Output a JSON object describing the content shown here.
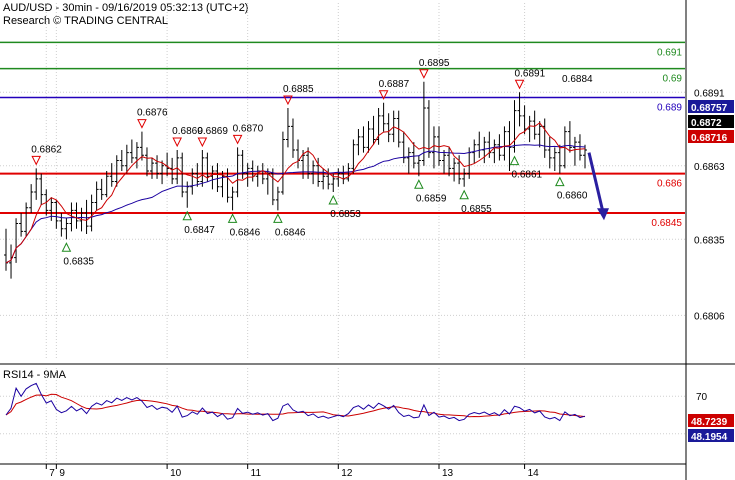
{
  "header": {
    "line1": "AUD/USD - 30min - 09/16/2019 05:32:13 (UTC+2)",
    "line2": "Research © TRADING CENTRAL"
  },
  "colors": {
    "candle": "#000000",
    "ma_fast": "#cc0000",
    "ma_slow": "#1a00a0",
    "level_red": "#e00000",
    "level_green": "#1f8a1f",
    "level_blue": "#2200bb",
    "grid": "#cfcfcf",
    "arrow": "#2a1fa0",
    "rsi": "#1a00a0",
    "rsi_ma": "#cc0000"
  },
  "chart_data": [
    {
      "type": "candlestick",
      "title": "AUD/USD - 30min",
      "ylim": [
        0.6789,
        0.6925
      ],
      "y_ticks": [
        0.6891,
        0.6863,
        0.6835,
        0.6806
      ],
      "x_ticks": [
        "7",
        "9",
        "10",
        "11",
        "12",
        "13",
        "14"
      ],
      "price_tags": [
        {
          "value": 0.68757,
          "label": "0.68757",
          "bg": "#1a1a99",
          "fg": "#ffffff"
        },
        {
          "value": 0.6872,
          "label": "0.6872",
          "bg": "#000000",
          "fg": "#ffffff"
        },
        {
          "value": 0.68716,
          "label": "0.68716",
          "bg": "#cc0000",
          "fg": "#ffffff"
        }
      ],
      "levels": [
        {
          "value": 0.691,
          "label": "0.691",
          "color": "level_green"
        },
        {
          "value": 0.69,
          "label": "0.69",
          "color": "level_green"
        },
        {
          "value": 0.6889,
          "label": "0.689",
          "color": "level_blue"
        },
        {
          "value": 0.686,
          "label": "0.686",
          "color": "level_red"
        },
        {
          "value": 0.6845,
          "label": "0.6845",
          "color": "level_red"
        }
      ],
      "swing_highs": [
        {
          "i": 6,
          "label": "0.6862"
        },
        {
          "i": 27,
          "label": "0.6876"
        },
        {
          "i": 34,
          "label": "0.6869"
        },
        {
          "i": 39,
          "label": "0.6869"
        },
        {
          "i": 46,
          "label": "0.6870"
        },
        {
          "i": 56,
          "label": "0.6885"
        },
        {
          "i": 75,
          "label": "0.6887"
        },
        {
          "i": 83,
          "label": "0.6895"
        },
        {
          "i": 102,
          "label": "0.6891"
        }
      ],
      "swing_lows": [
        {
          "i": 12,
          "label": "0.6835"
        },
        {
          "i": 36,
          "label": "0.6847"
        },
        {
          "i": 45,
          "label": "0.6846"
        },
        {
          "i": 54,
          "label": "0.6846"
        },
        {
          "i": 65,
          "label": "0.6853"
        },
        {
          "i": 82,
          "label": "0.6859"
        },
        {
          "i": 91,
          "label": "0.6855"
        },
        {
          "i": 101,
          "label": "0.6861"
        },
        {
          "i": 110,
          "label": "0.6860"
        }
      ],
      "top_right_label": "0.6884",
      "forecast_arrow": {
        "from": 0.6868,
        "to": 0.6843
      },
      "candles": [
        [
          0.6829,
          0.6839,
          0.6823,
          0.6826
        ],
        [
          0.6826,
          0.6833,
          0.682,
          0.6828
        ],
        [
          0.6828,
          0.6843,
          0.6826,
          0.6841
        ],
        [
          0.6841,
          0.6845,
          0.6836,
          0.6838
        ],
        [
          0.6838,
          0.6849,
          0.6836,
          0.6847
        ],
        [
          0.6847,
          0.6856,
          0.6845,
          0.6853
        ],
        [
          0.6853,
          0.6862,
          0.685,
          0.6858
        ],
        [
          0.6858,
          0.686,
          0.6848,
          0.6852
        ],
        [
          0.6852,
          0.6854,
          0.6844,
          0.6846
        ],
        [
          0.6846,
          0.6851,
          0.6842,
          0.6849
        ],
        [
          0.6849,
          0.685,
          0.6839,
          0.6842
        ],
        [
          0.6842,
          0.6845,
          0.6836,
          0.6839
        ],
        [
          0.6839,
          0.6843,
          0.6835,
          0.6841
        ],
        [
          0.6841,
          0.6849,
          0.6838,
          0.6846
        ],
        [
          0.6846,
          0.6849,
          0.6839,
          0.6842
        ],
        [
          0.6842,
          0.6847,
          0.6838,
          0.6845
        ],
        [
          0.6845,
          0.685,
          0.6837,
          0.684
        ],
        [
          0.684,
          0.6852,
          0.6838,
          0.6849
        ],
        [
          0.6849,
          0.6857,
          0.6846,
          0.6854
        ],
        [
          0.6854,
          0.6858,
          0.685,
          0.6852
        ],
        [
          0.6852,
          0.6861,
          0.6851,
          0.6859
        ],
        [
          0.6859,
          0.6864,
          0.6855,
          0.6857
        ],
        [
          0.6857,
          0.6867,
          0.6855,
          0.6865
        ],
        [
          0.6865,
          0.6869,
          0.6861,
          0.6863
        ],
        [
          0.6863,
          0.6871,
          0.686,
          0.6868
        ],
        [
          0.6868,
          0.6873,
          0.6864,
          0.6866
        ],
        [
          0.6866,
          0.6872,
          0.6862,
          0.687
        ],
        [
          0.687,
          0.6876,
          0.6865,
          0.6867
        ],
        [
          0.6867,
          0.687,
          0.6859,
          0.6861
        ],
        [
          0.6861,
          0.6866,
          0.6858,
          0.6864
        ],
        [
          0.6864,
          0.6867,
          0.6858,
          0.686
        ],
        [
          0.686,
          0.6865,
          0.6856,
          0.6863
        ],
        [
          0.6863,
          0.6868,
          0.6859,
          0.6862
        ],
        [
          0.6862,
          0.6866,
          0.6856,
          0.6858
        ],
        [
          0.6858,
          0.6869,
          0.6856,
          0.6866
        ],
        [
          0.6866,
          0.6868,
          0.6851,
          0.6853
        ],
        [
          0.6853,
          0.6857,
          0.6847,
          0.6855
        ],
        [
          0.6855,
          0.6862,
          0.6852,
          0.686
        ],
        [
          0.686,
          0.6864,
          0.6855,
          0.6857
        ],
        [
          0.6857,
          0.6869,
          0.6855,
          0.6866
        ],
        [
          0.6866,
          0.6868,
          0.6857,
          0.6859
        ],
        [
          0.6859,
          0.6863,
          0.6854,
          0.6861
        ],
        [
          0.6861,
          0.6864,
          0.6853,
          0.6855
        ],
        [
          0.6855,
          0.6861,
          0.6851,
          0.6859
        ],
        [
          0.6859,
          0.6862,
          0.6849,
          0.6851
        ],
        [
          0.6851,
          0.6855,
          0.6846,
          0.6853
        ],
        [
          0.6853,
          0.687,
          0.6851,
          0.6867
        ],
        [
          0.6867,
          0.6869,
          0.6858,
          0.686
        ],
        [
          0.686,
          0.6864,
          0.6855,
          0.6862
        ],
        [
          0.6862,
          0.6865,
          0.6857,
          0.6859
        ],
        [
          0.6859,
          0.6863,
          0.6855,
          0.6861
        ],
        [
          0.6861,
          0.6864,
          0.6856,
          0.6858
        ],
        [
          0.6858,
          0.6862,
          0.6852,
          0.686
        ],
        [
          0.686,
          0.6862,
          0.6848,
          0.685
        ],
        [
          0.685,
          0.6855,
          0.6846,
          0.6853
        ],
        [
          0.6853,
          0.6876,
          0.6852,
          0.6873
        ],
        [
          0.6873,
          0.6885,
          0.687,
          0.6878
        ],
        [
          0.6878,
          0.6881,
          0.6866,
          0.6869
        ],
        [
          0.6869,
          0.6873,
          0.6862,
          0.6865
        ],
        [
          0.6865,
          0.6869,
          0.6858,
          0.6867
        ],
        [
          0.6867,
          0.687,
          0.6858,
          0.686
        ],
        [
          0.686,
          0.6865,
          0.6856,
          0.6863
        ],
        [
          0.6863,
          0.6866,
          0.6855,
          0.6857
        ],
        [
          0.6857,
          0.6862,
          0.6854,
          0.6859
        ],
        [
          0.6859,
          0.6862,
          0.6854,
          0.6856
        ],
        [
          0.6856,
          0.686,
          0.6853,
          0.6858
        ],
        [
          0.6858,
          0.6862,
          0.6855,
          0.686
        ],
        [
          0.686,
          0.6863,
          0.6856,
          0.6858
        ],
        [
          0.6858,
          0.6864,
          0.6857,
          0.6862
        ],
        [
          0.6862,
          0.6873,
          0.686,
          0.6871
        ],
        [
          0.6871,
          0.6877,
          0.6867,
          0.6874
        ],
        [
          0.6874,
          0.6878,
          0.6868,
          0.687
        ],
        [
          0.687,
          0.688,
          0.6868,
          0.6877
        ],
        [
          0.6877,
          0.6882,
          0.6871,
          0.6873
        ],
        [
          0.6873,
          0.6885,
          0.6871,
          0.6882
        ],
        [
          0.6882,
          0.6887,
          0.6876,
          0.6879
        ],
        [
          0.6879,
          0.6883,
          0.6872,
          0.6875
        ],
        [
          0.6875,
          0.6884,
          0.6872,
          0.6881
        ],
        [
          0.6881,
          0.6884,
          0.687,
          0.6872
        ],
        [
          0.6872,
          0.6876,
          0.6864,
          0.6866
        ],
        [
          0.6866,
          0.687,
          0.686,
          0.6868
        ],
        [
          0.6868,
          0.6872,
          0.6862,
          0.6864
        ],
        [
          0.6864,
          0.6867,
          0.6859,
          0.6865
        ],
        [
          0.6865,
          0.6895,
          0.6863,
          0.6885
        ],
        [
          0.6885,
          0.6888,
          0.6866,
          0.6868
        ],
        [
          0.6868,
          0.6878,
          0.6862,
          0.6874
        ],
        [
          0.6874,
          0.6878,
          0.6863,
          0.6865
        ],
        [
          0.6865,
          0.6869,
          0.686,
          0.6867
        ],
        [
          0.6867,
          0.687,
          0.6859,
          0.6862
        ],
        [
          0.6862,
          0.6866,
          0.6857,
          0.6864
        ],
        [
          0.6864,
          0.6867,
          0.6856,
          0.6858
        ],
        [
          0.6858,
          0.6862,
          0.6855,
          0.686
        ],
        [
          0.686,
          0.687,
          0.6858,
          0.6868
        ],
        [
          0.6868,
          0.6873,
          0.6864,
          0.6871
        ],
        [
          0.6871,
          0.6876,
          0.6866,
          0.6869
        ],
        [
          0.6869,
          0.6874,
          0.6864,
          0.6872
        ],
        [
          0.6872,
          0.6876,
          0.6866,
          0.6868
        ],
        [
          0.6868,
          0.6873,
          0.6864,
          0.6871
        ],
        [
          0.6871,
          0.6875,
          0.6865,
          0.6867
        ],
        [
          0.6867,
          0.6878,
          0.6865,
          0.6876
        ],
        [
          0.6876,
          0.688,
          0.6861,
          0.687
        ],
        [
          0.687,
          0.6888,
          0.6868,
          0.6884
        ],
        [
          0.6884,
          0.6891,
          0.6878,
          0.6882
        ],
        [
          0.6882,
          0.6886,
          0.6875,
          0.6877
        ],
        [
          0.6877,
          0.6882,
          0.6872,
          0.688
        ],
        [
          0.688,
          0.6884,
          0.6873,
          0.6875
        ],
        [
          0.6875,
          0.688,
          0.687,
          0.6878
        ],
        [
          0.6878,
          0.6881,
          0.6866,
          0.6869
        ],
        [
          0.6869,
          0.6874,
          0.6862,
          0.6866
        ],
        [
          0.6866,
          0.687,
          0.6861,
          0.6868
        ],
        [
          0.6868,
          0.6871,
          0.686,
          0.6863
        ],
        [
          0.6863,
          0.6878,
          0.6862,
          0.6876
        ],
        [
          0.6876,
          0.688,
          0.6868,
          0.687
        ],
        [
          0.687,
          0.6874,
          0.6863,
          0.6872
        ],
        [
          0.6872,
          0.6875,
          0.6865,
          0.6867
        ],
        [
          0.6867,
          0.6871,
          0.6862,
          0.6869
        ]
      ]
    },
    {
      "type": "line",
      "title": "RSI14 - 9MA",
      "ylim": [
        0,
        100
      ],
      "y_ticks": [
        70
      ],
      "series": [
        {
          "name": "RSI14",
          "color": "rsi"
        },
        {
          "name": "9MA",
          "color": "rsi_ma"
        }
      ],
      "last_values": [
        {
          "value": 48.7239,
          "label": "48.7239",
          "bg": "#cc0000"
        },
        {
          "value": 48.1954,
          "label": "48.1954",
          "bg": "#1a1a99"
        }
      ]
    }
  ]
}
